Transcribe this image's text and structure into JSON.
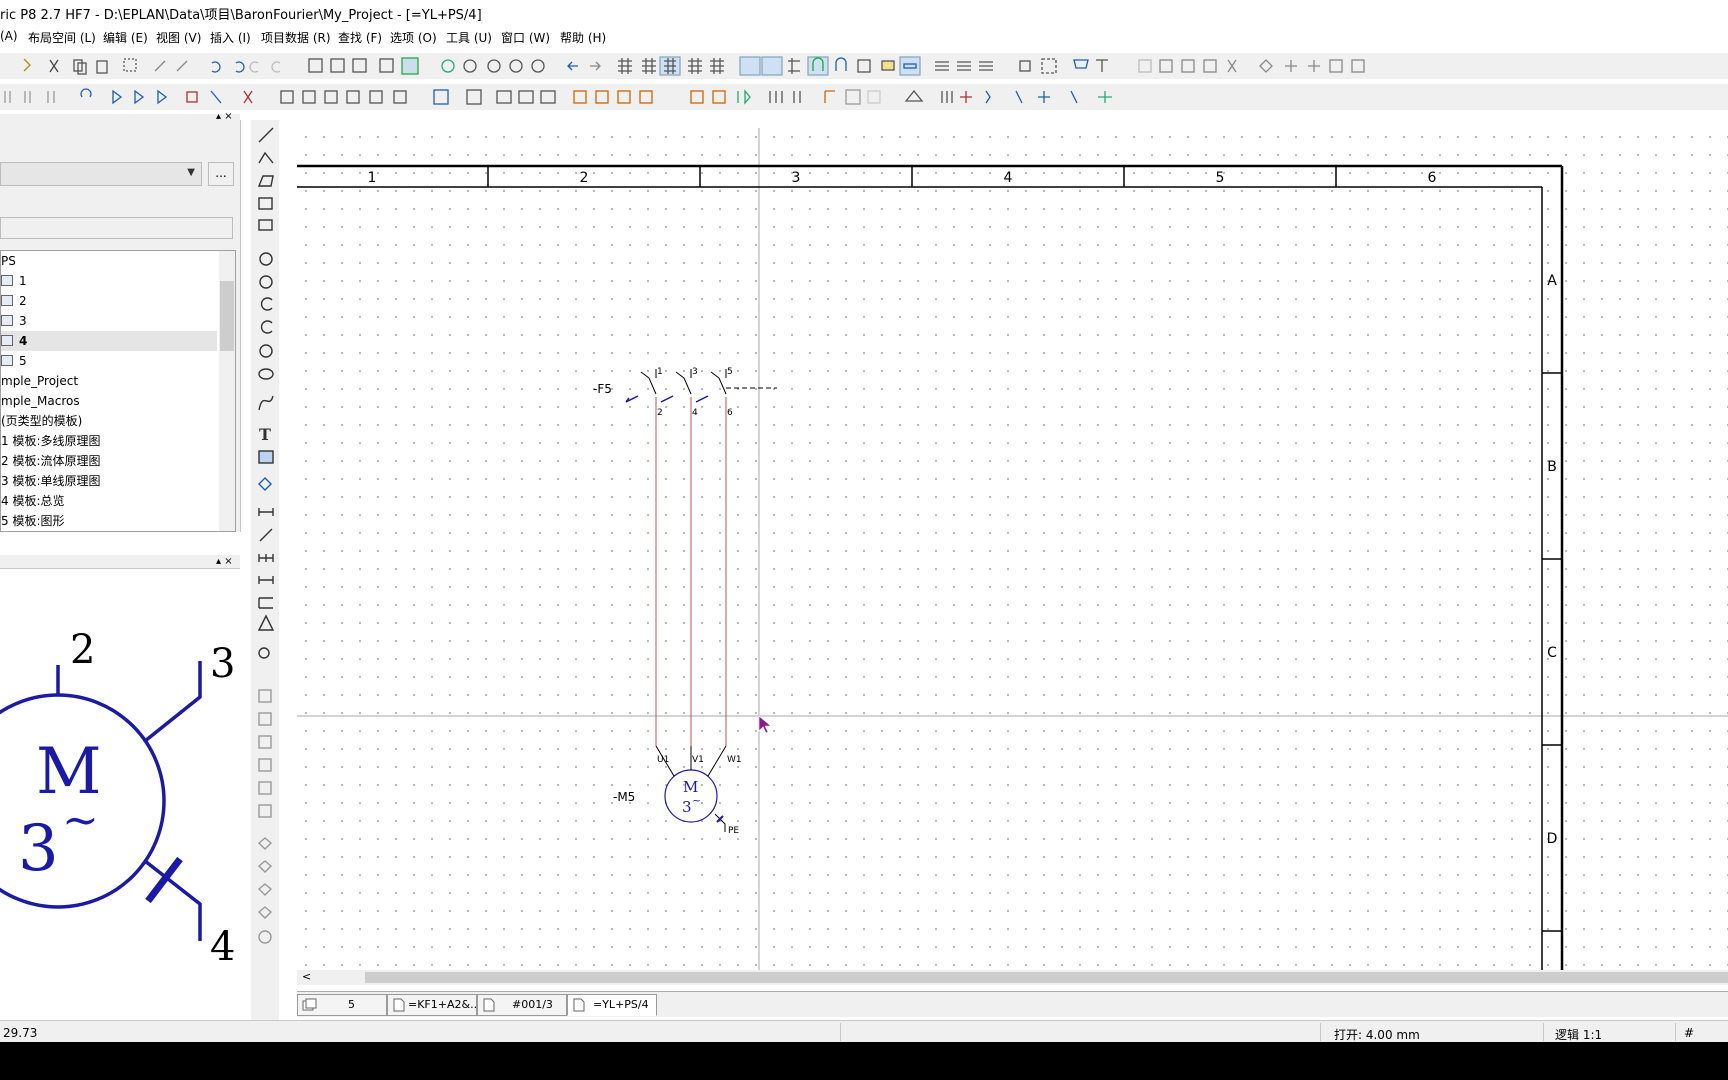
{
  "window": {
    "title": "ric P8 2.7 HF7 - D:\\EPLAN\\Data\\项目\\BaronFourier\\My_Project - [=YL+PS/4]"
  },
  "menu": [
    {
      "label": "(A)"
    },
    {
      "label": "布局空间 (L)"
    },
    {
      "label": "编辑 (E)"
    },
    {
      "label": "视图 (V)"
    },
    {
      "label": "插入 (I)"
    },
    {
      "label": "项目数据 (R)"
    },
    {
      "label": "查找 (F)"
    },
    {
      "label": "选项 (O)"
    },
    {
      "label": "工具 (U)"
    },
    {
      "label": "窗口 (W)"
    },
    {
      "label": "帮助 (H)"
    }
  ],
  "page_navigator": {
    "panel_controls": "▴ ×",
    "combo_value": "",
    "more_button": "...",
    "filter_value": "",
    "tree": [
      {
        "label": "PS",
        "icon": "none"
      },
      {
        "label": "1",
        "icon": "page-icon"
      },
      {
        "label": "2",
        "icon": "page-icon"
      },
      {
        "label": "3",
        "icon": "page-icon"
      },
      {
        "label": "4",
        "icon": "page-icon",
        "selected": true
      },
      {
        "label": "5",
        "icon": "page-icon"
      },
      {
        "label": "mple_Project",
        "icon": "none"
      },
      {
        "label": "mple_Macros",
        "icon": "none"
      },
      {
        "label": " (页类型的模板)",
        "icon": "none"
      },
      {
        "label": "1 模板:多线原理图",
        "icon": "none"
      },
      {
        "label": "2 模板:流体原理图",
        "icon": "none"
      },
      {
        "label": "3 模板:单线原理图",
        "icon": "none"
      },
      {
        "label": "4 模板:总览",
        "icon": "none"
      },
      {
        "label": "5 模板:图形",
        "icon": "none"
      }
    ]
  },
  "preview": {
    "panel_controls": "▴ ×",
    "labels": {
      "pin2": "2",
      "pin3": "3",
      "pin4": "4",
      "motor_letter": "M",
      "motor_phase": "3",
      "tilde": "~"
    },
    "symbol_color": "#1a1aa6"
  },
  "schematic": {
    "columns": [
      "1",
      "2",
      "3",
      "4",
      "5",
      "6"
    ],
    "rows": [
      "A",
      "B",
      "C",
      "D"
    ],
    "fuse_tag": "-F5",
    "fuse_pins_top": [
      "1",
      "3",
      "5"
    ],
    "fuse_pins_bottom": [
      "2",
      "4",
      "6"
    ],
    "motor_tag": "-M5",
    "motor_letter": "M",
    "motor_phase": "3",
    "motor_tilde": "~",
    "motor_terminals": [
      "U1",
      "V1",
      "W1"
    ],
    "pe_label": "PE",
    "wire_color": "#c05050",
    "symbol_color": "#1a1aa6",
    "frame_color": "#000000"
  },
  "hscroll": {
    "left_arrow": "<"
  },
  "tabs": [
    {
      "label": "5"
    },
    {
      "label": "=KF1+A2&..."
    },
    {
      "label": "#001/3"
    },
    {
      "label": "=YL+PS/4",
      "active": true
    }
  ],
  "status": {
    "coordinate": "29.73",
    "grid": "打开: 4.00 mm",
    "logic": "逻辑 1:1",
    "hash": "#"
  }
}
